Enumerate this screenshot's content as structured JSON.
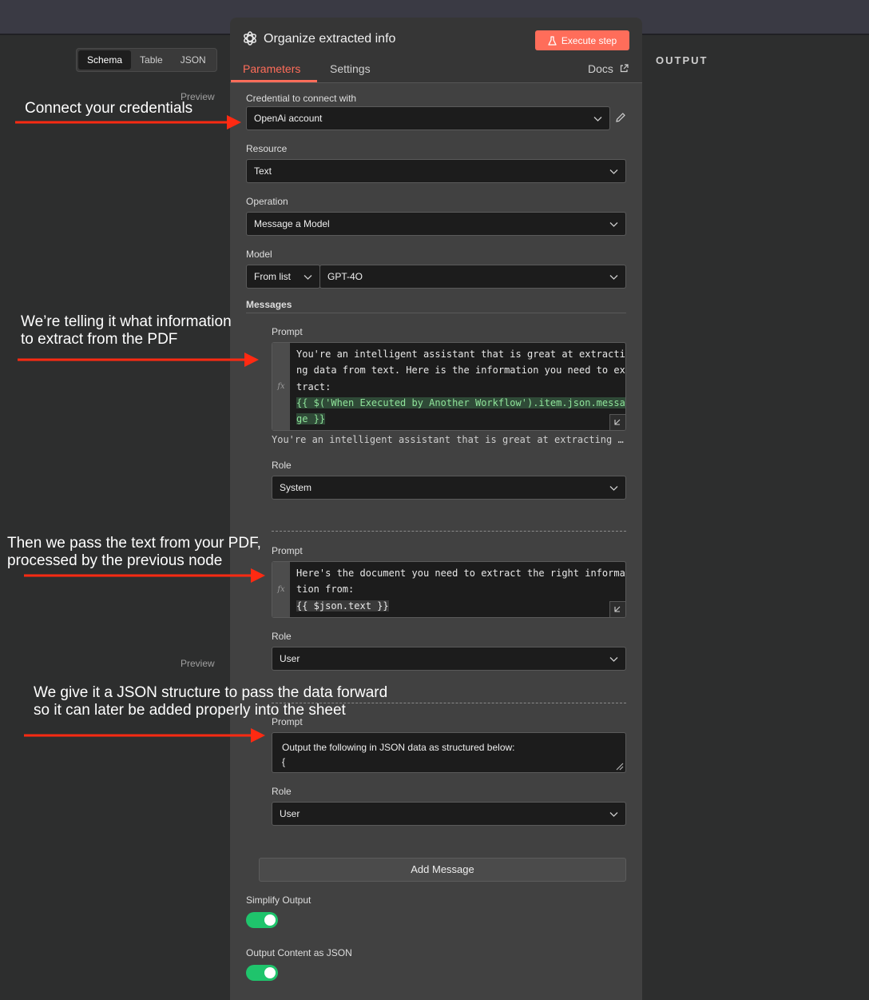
{
  "left": {
    "tabs": [
      "Schema",
      "Table",
      "JSON"
    ],
    "active_tab": "Schema",
    "preview_label": "Preview"
  },
  "right": {
    "output_label": "OUTPUT"
  },
  "node": {
    "title": "Organize extracted info",
    "logo_icon": "openai-icon",
    "execute_label": "Execute step",
    "tabs": [
      "Parameters",
      "Settings"
    ],
    "active_tab": "Parameters",
    "docs_label": "Docs"
  },
  "params": {
    "credential": {
      "label": "Credential to connect with",
      "value": "OpenAi account"
    },
    "resource": {
      "label": "Resource",
      "value": "Text"
    },
    "operation": {
      "label": "Operation",
      "value": "Message a Model"
    },
    "model": {
      "label": "Model",
      "mode": "From list",
      "value": "GPT-4O"
    },
    "messages_label": "Messages",
    "messages": [
      {
        "prompt_label": "Prompt",
        "lines": [
          "You're an intelligent assistant that is great at extracti",
          "ng data from text. Here is the information you need to ex",
          "tract:",
          "{{ $('When Executed by Another Workflow').item.json.messa",
          "ge }}"
        ],
        "result": "You're an intelligent assistant that is great at extracting …",
        "role_label": "Role",
        "role": "System"
      },
      {
        "prompt_label": "Prompt",
        "lines": [
          "Here's the document you need to extract the right informa",
          "tion from:",
          "{{ $json.text }}"
        ],
        "role_label": "Role",
        "role": "User"
      },
      {
        "prompt_label": "Prompt",
        "text_lines": [
          "Output the following in JSON data as structured below:",
          "{"
        ],
        "role_label": "Role",
        "role": "User"
      }
    ],
    "add_message_label": "Add Message",
    "simplify_output": {
      "label": "Simplify Output",
      "on": true
    },
    "output_json": {
      "label": "Output Content as JSON",
      "on": true
    }
  },
  "annotations": {
    "credentials": "Connect your credentials",
    "extract_what": "We’re telling it what information\nto extract from the PDF",
    "pass_text": "Then we pass the text from your PDF,\nprocessed by the previous node",
    "json_structure": "We give it a JSON structure to pass the data forward\nso it can later be added properly into the sheet"
  },
  "colors": {
    "accent": "#ff6d5a",
    "toggle_on": "#1fc46c",
    "annotation_arrow": "#ff2a12"
  }
}
